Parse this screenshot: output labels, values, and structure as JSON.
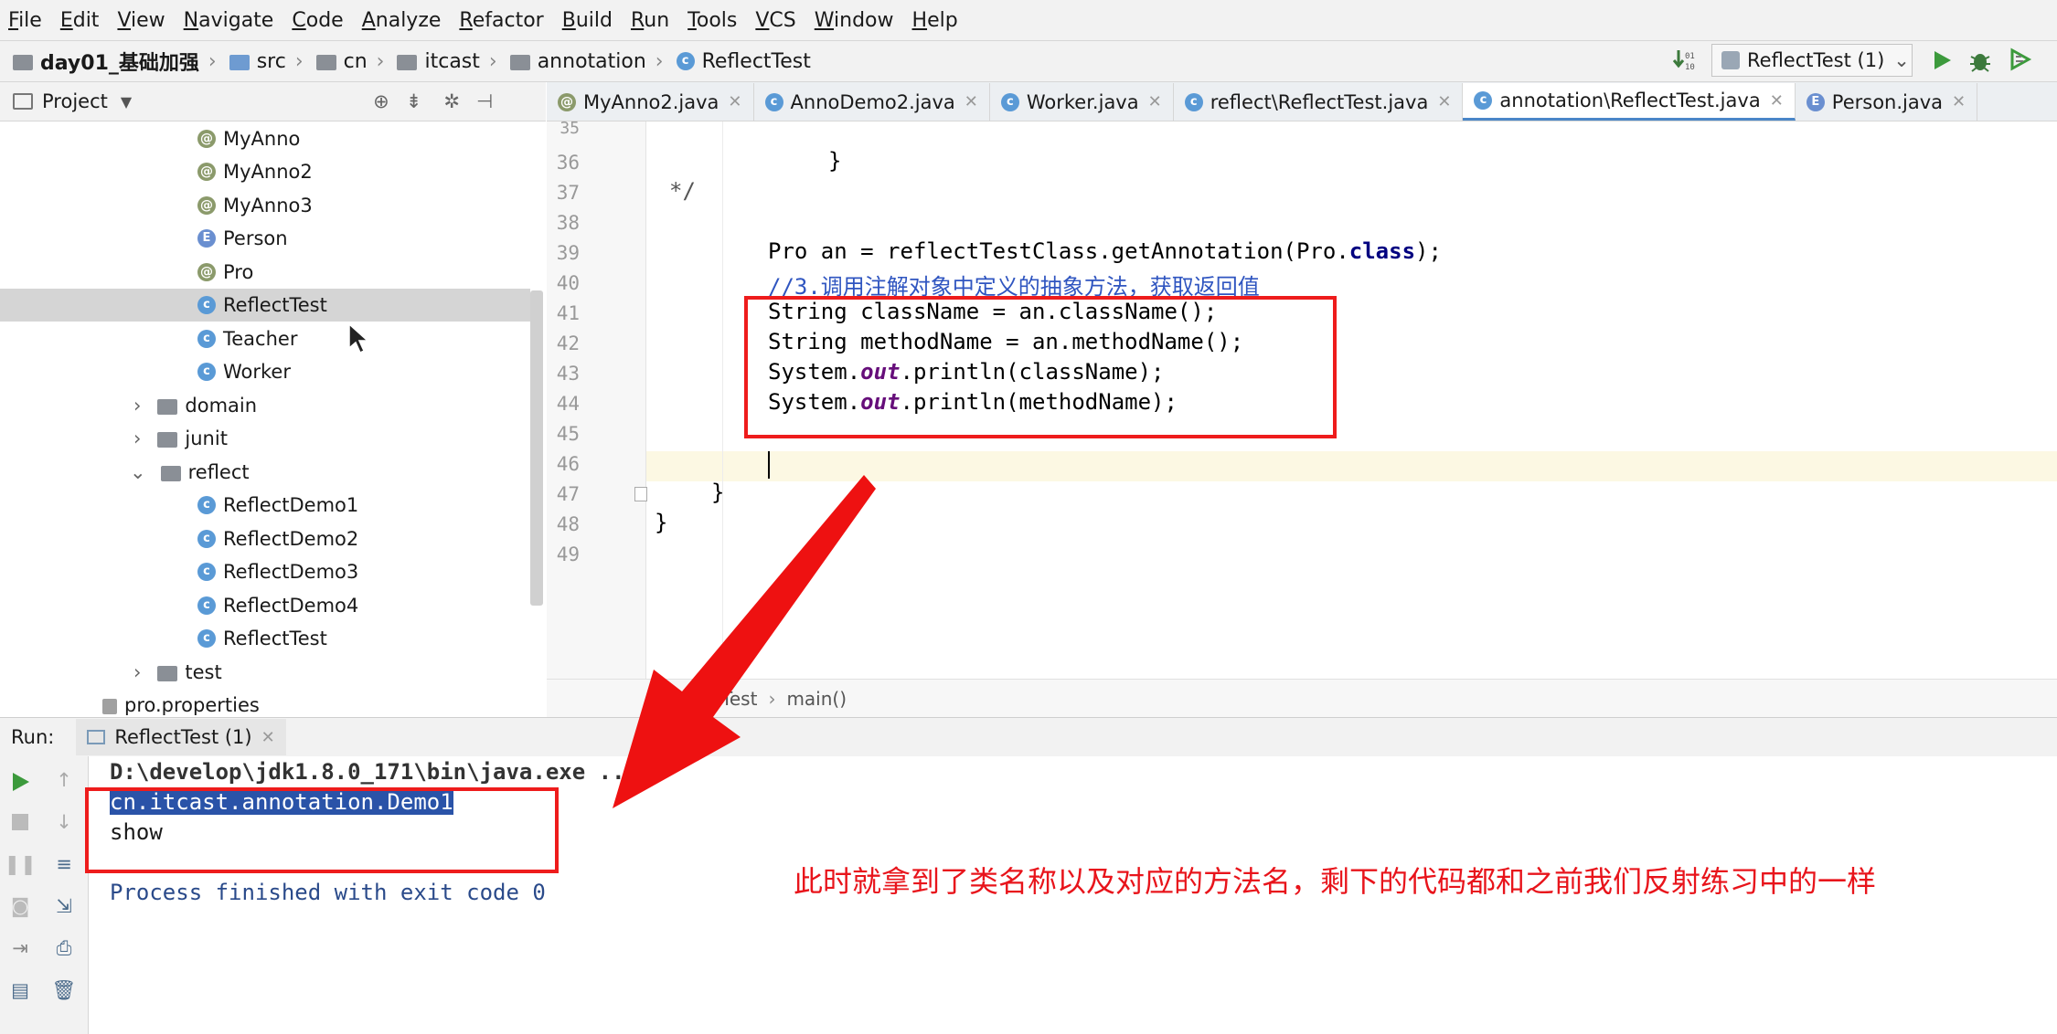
{
  "menu": [
    "File",
    "Edit",
    "View",
    "Navigate",
    "Code",
    "Analyze",
    "Refactor",
    "Build",
    "Run",
    "Tools",
    "VCS",
    "Window",
    "Help"
  ],
  "breadcrumbs": [
    "day01_基础加强",
    "src",
    "cn",
    "itcast",
    "annotation",
    "ReflectTest"
  ],
  "run_config": "ReflectTest (1)",
  "project_panel": {
    "title": "Project"
  },
  "tree": [
    {
      "label": "MyAnno",
      "icon": "annotation-icon"
    },
    {
      "label": "MyAnno2",
      "icon": "annotation-icon"
    },
    {
      "label": "MyAnno3",
      "icon": "annotation-icon"
    },
    {
      "label": "Person",
      "icon": "enum-icon"
    },
    {
      "label": "Pro",
      "icon": "annotation-icon"
    },
    {
      "label": "ReflectTest",
      "icon": "class-icon"
    },
    {
      "label": "Teacher",
      "icon": "class-icon"
    },
    {
      "label": "Worker",
      "icon": "class-icon"
    },
    {
      "label": "domain",
      "icon": "package-icon"
    },
    {
      "label": "junit",
      "icon": "package-icon"
    },
    {
      "label": "reflect",
      "icon": "package-icon"
    },
    {
      "label": "ReflectDemo1",
      "icon": "class-icon"
    },
    {
      "label": "ReflectDemo2",
      "icon": "class-icon"
    },
    {
      "label": "ReflectDemo3",
      "icon": "class-icon"
    },
    {
      "label": "ReflectDemo4",
      "icon": "class-icon"
    },
    {
      "label": "ReflectTest",
      "icon": "class-icon"
    },
    {
      "label": "test",
      "icon": "package-icon"
    },
    {
      "label": "pro.properties",
      "icon": "file-icon"
    }
  ],
  "tabs": [
    {
      "label": "MyAnno2.java"
    },
    {
      "label": "AnnoDemo2.java"
    },
    {
      "label": "Worker.java"
    },
    {
      "label": "reflect\\ReflectTest.java"
    },
    {
      "label": "annotation\\ReflectTest.java"
    },
    {
      "label": "Person.java"
    }
  ],
  "line_numbers": [
    "35",
    "36",
    "37",
    "38",
    "39",
    "40",
    "41",
    "42",
    "43",
    "44",
    "45",
    "46",
    "47",
    "48",
    "49"
  ],
  "code": {
    "l36": "}",
    "l37": "*/",
    "l39a": "Pro an = reflectTestClass.getAnnotation(Pro.",
    "l39kw": "class",
    "l39b": ");",
    "l40": "//3.调用注解对象中定义的抽象方法，获取返回值",
    "l41": "String className = an.className();",
    "l42": "String methodName = an.methodName();",
    "l43a": "System.",
    "l43b": "out",
    "l43c": ".println(className);",
    "l44a": "System.",
    "l44b": "out",
    "l44c": ".println(methodName);",
    "l47": "}",
    "l48": "}"
  },
  "editor_breadcrumb": [
    "ReflectTest",
    "main()"
  ],
  "run_panel": {
    "label": "Run:",
    "tab": "ReflectTest (1)"
  },
  "console": {
    "cmd": "D:\\develop\\jdk1.8.0_171\\bin\\java.exe ...",
    "out1": "cn.itcast.annotation.Demo1",
    "out2": "show",
    "exit": "Process finished with exit code 0"
  },
  "annotation_note": "此时就拿到了类名称以及对应的方法名，剩下的代码都和之前我们反射练习中的一样",
  "colors": {
    "annotation_red": "#ee1c1c",
    "run_green": "#3c9a3c",
    "selection_blue": "#2a53a8"
  }
}
